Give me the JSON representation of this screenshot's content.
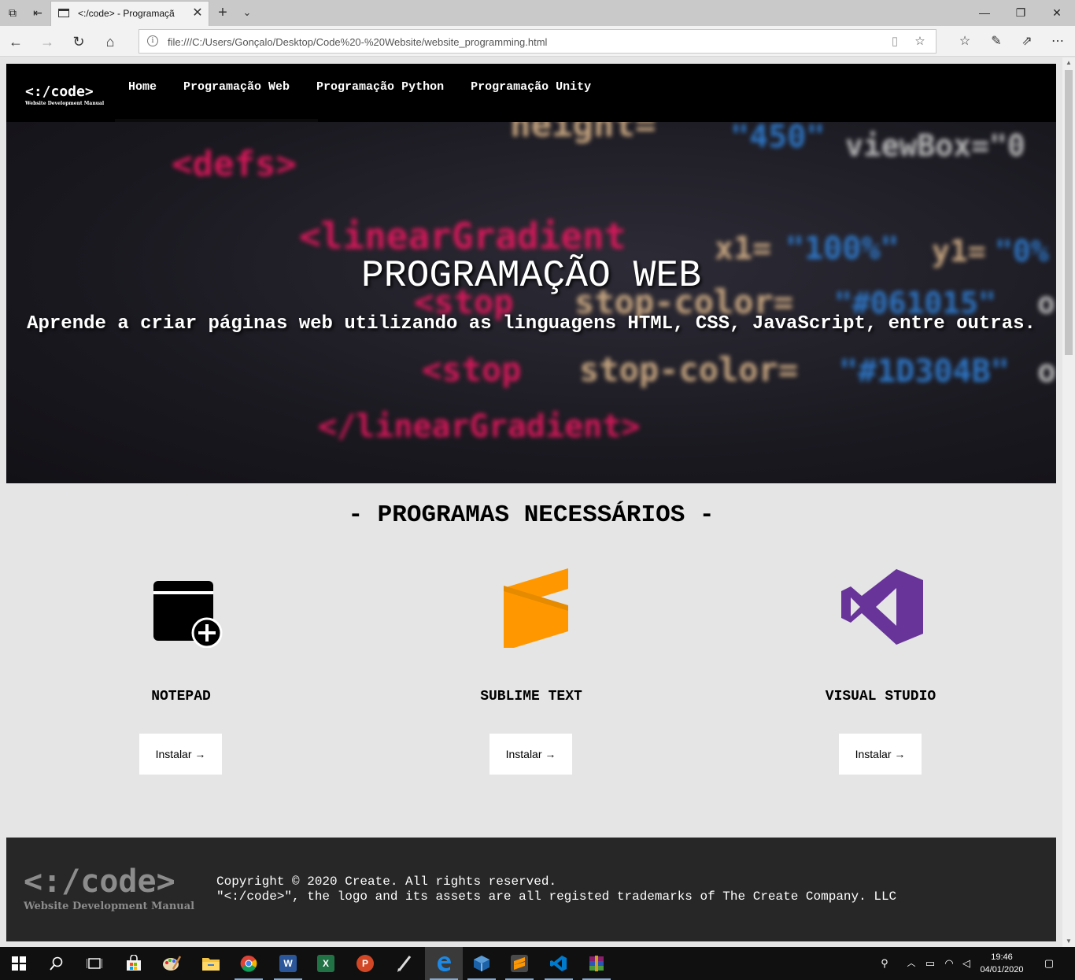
{
  "browser": {
    "tab_title": "<:/code> - Programaçã",
    "address": "file:///C:/Users/Gonçalo/Desktop/Code%20-%20Website/website_programming.html",
    "icons": [
      "tab-preview-icon",
      "set-aside-tabs-icon",
      "close-icon",
      "new-tab-icon",
      "chevron-down-icon",
      "back-icon",
      "forward-icon",
      "refresh-icon",
      "home-icon",
      "info-icon",
      "reading-view-icon",
      "favorite-star-icon",
      "favorites-hub-icon",
      "pen-icon",
      "share-icon",
      "more-icon",
      "minimize-icon",
      "maximize-icon",
      "window-close-icon"
    ]
  },
  "site": {
    "logo_main": "<:/code>",
    "logo_sub": "Website Development Manual",
    "nav": [
      "Home",
      "Programação Web",
      "Programação Python",
      "Programação Unity"
    ],
    "hero": {
      "title": "PROGRAMAÇÃO WEB",
      "subtitle": "Aprende a criar páginas web utilizando as linguagens HTML, CSS, JavaScript, entre outras."
    },
    "background_code": {
      "line1": "<defs>",
      "line2_a": "height=",
      "line2_b": "\"450\"",
      "line2_c": "viewBox=\"0",
      "line3_a": "<linearGradient",
      "line3_b": "x1=",
      "line3_c": "\"100%\"",
      "line3_d": "y1=",
      "line3_e": "\"0%",
      "line4_a": "<stop",
      "line4_b": "stop-color=",
      "line4_c": "\"#061015\"",
      "line4_d": "o",
      "line5_a": "<stop",
      "line5_b": "stop-color=",
      "line5_c": "\"#1D304B\"",
      "line5_d": "o",
      "line6": "</linearGradient>"
    },
    "section_title": "- PROGRAMAS NECESSÁRIOS -",
    "programs": [
      {
        "name": "NOTEPAD",
        "button": "Instalar →",
        "icon": "notepad-icon"
      },
      {
        "name": "SUBLIME TEXT",
        "button": "Instalar →",
        "icon": "sublime-text-icon"
      },
      {
        "name": "VISUAL STUDIO",
        "button": "Instalar →",
        "icon": "visual-studio-icon"
      }
    ],
    "footer": {
      "logo_main": "<:/code>",
      "logo_sub": "Website Development Manual",
      "line1": "Copyright © 2020 Create. All rights reserved.",
      "line2": "\"<:/code>\", the logo and its assets are all registed trademarks of The Create Company. LLC"
    }
  },
  "taskbar": {
    "time": "19:46",
    "date": "04/01/2020",
    "apps": [
      "start-icon",
      "search-icon",
      "task-view-icon",
      "store-icon",
      "paint-icon",
      "file-explorer-icon",
      "chrome-icon",
      "word-icon",
      "excel-icon",
      "powerpoint-icon",
      "pen-app-icon",
      "edge-icon",
      "virtualbox-icon",
      "sublime-icon",
      "vscode-icon",
      "winrar-icon"
    ],
    "word_letter": "W",
    "excel_letter": "X",
    "powerpoint_letter": "P"
  },
  "colors": {
    "nav_bg": "#000000",
    "page_bg": "#e5e5e5",
    "footer_bg": "#272727",
    "sublime_orange": "#ff9800",
    "vs_purple": "#68349a",
    "code_pink": "#e8185f",
    "code_tan": "#d9b48a",
    "code_blue": "#2f7fd6"
  }
}
